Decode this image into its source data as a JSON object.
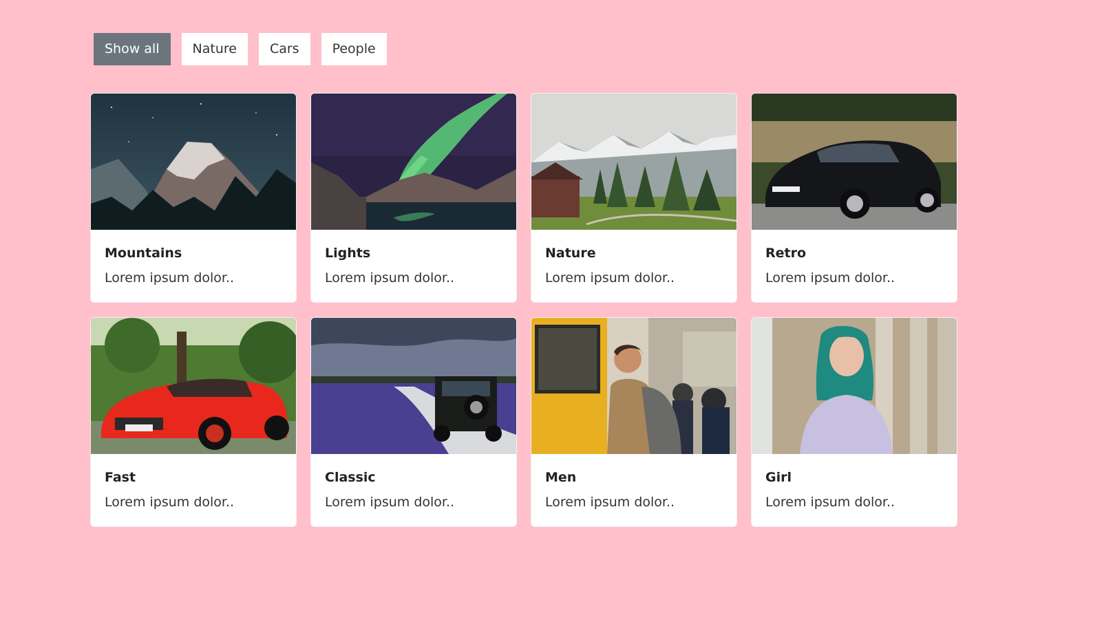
{
  "filters": [
    {
      "label": "Show all",
      "active": true
    },
    {
      "label": "Nature",
      "active": false
    },
    {
      "label": "Cars",
      "active": false
    },
    {
      "label": "People",
      "active": false
    }
  ],
  "cards": [
    {
      "title": "Mountains",
      "text": "Lorem ipsum dolor..",
      "image": "mountain-night-image"
    },
    {
      "title": "Lights",
      "text": "Lorem ipsum dolor..",
      "image": "northern-lights-image"
    },
    {
      "title": "Nature",
      "text": "Lorem ipsum dolor..",
      "image": "alpine-valley-image"
    },
    {
      "title": "Retro",
      "text": "Lorem ipsum dolor..",
      "image": "black-hatchback-image"
    },
    {
      "title": "Fast",
      "text": "Lorem ipsum dolor..",
      "image": "red-sports-car-image"
    },
    {
      "title": "Classic",
      "text": "Lorem ipsum dolor..",
      "image": "offroad-jeep-image"
    },
    {
      "title": "Men",
      "text": "Lorem ipsum dolor..",
      "image": "man-train-station-image"
    },
    {
      "title": "Girl",
      "text": "Lorem ipsum dolor..",
      "image": "teal-hair-girl-image"
    }
  ],
  "colors": {
    "page_background": "#ffc0cb",
    "active_filter": "#6c757d",
    "card_background": "#ffffff"
  }
}
